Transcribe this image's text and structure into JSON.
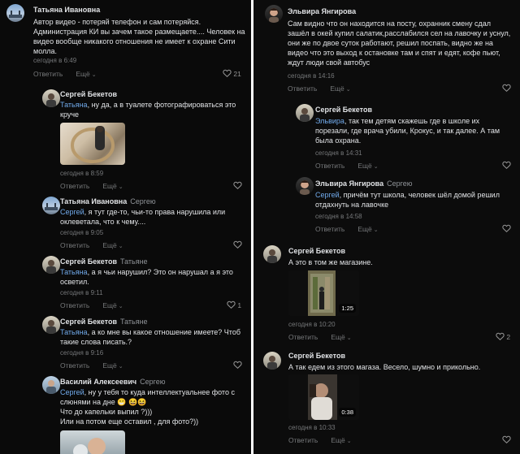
{
  "ui": {
    "reply_label": "Ответить",
    "more_label": "Ещё"
  },
  "left": {
    "c1": {
      "author": "Татьяна Ивановна",
      "text": "Автор видео - потеряй телефон и сам потеряйся. Администрация КИ вы зачем такое размещаете.... Человек на видео вообще никакого отношения не имеет к охране Сити молла.",
      "time": "сегодня в 6:49",
      "likes": "21"
    },
    "c2": {
      "author": "Сергей Бекетов",
      "mention": "Татьяна",
      "text": ", ну да, а в туалете фотографироваться это круче",
      "time": "сегодня в 8:59"
    },
    "c3": {
      "author": "Татьяна Ивановна",
      "reply_to": "Сергею",
      "mention": "Сергей",
      "text": ", я тут где-то, чьи-то права нарушила или оклеветала, что к чему....",
      "time": "сегодня в 9:05"
    },
    "c4": {
      "author": "Сергей Бекетов",
      "reply_to": "Татьяне",
      "mention": "Татьяна",
      "text": ", а я чьи нарушил? Это он нарушал а я это осветил.",
      "time": "сегодня в 9:11",
      "likes": "1"
    },
    "c5": {
      "author": "Сергей Бекетов",
      "reply_to": "Татьяне",
      "mention": "Татьяна",
      "text": ", а ко мне вы какое отношение имеете? Чтоб такие слова писать.?",
      "time": "сегодня в 9:16"
    },
    "c6": {
      "author": "Василий Алексеевич",
      "reply_to": "Сергею",
      "mention": "Сергей",
      "text": ", ну у тебя то куда интеллектуальнее фото с слюнями на дне 😁 😆😆\nЧто до капельки выпил ?)))\nИли на потом еще оставил , для фото?))"
    }
  },
  "right": {
    "r1": {
      "author": "Эльвира Янгирова",
      "text": "Сам видно что он находится на посту, охранник смену сдал зашёл в окей купил салатик,расслабился сел на лавочку и уснул, они же по двое суток работают, решил поспать, видно же на видео что это выход к остановке там и спят и едят, кофе пьют, ждут люди свой автобус",
      "time": "сегодня в 14:16"
    },
    "r2": {
      "author": "Сергей Бекетов",
      "mention": "Эльвира",
      "text": ", так тем детям скажешь где в школе их порезали, где врача убили, Крокус, и так далее. А там была охрана.",
      "time": "сегодня в 14:31"
    },
    "r3": {
      "author": "Эльвира Янгирова",
      "reply_to": "Сергею",
      "mention": "Сергей",
      "text": ", причём тут школа, человек шёл домой решил отдахнуть на лавочке",
      "time": "сегодня в 14:58"
    },
    "r4": {
      "author": "Сергей Бекетов",
      "text": "А это в том же магазине.",
      "duration": "1:25",
      "time": "сегодня в 10:20",
      "likes": "2"
    },
    "r5": {
      "author": "Сергей Бекетов",
      "text": "А так едем из этого магаза. Весело, шумно и прикольно.",
      "duration": "0:38",
      "time": "сегодня в 10:33"
    }
  },
  "colors": {
    "background": "#0a0a0a",
    "text": "#e1e3e6",
    "mention": "#71aaeb",
    "muted": "#76787a"
  }
}
